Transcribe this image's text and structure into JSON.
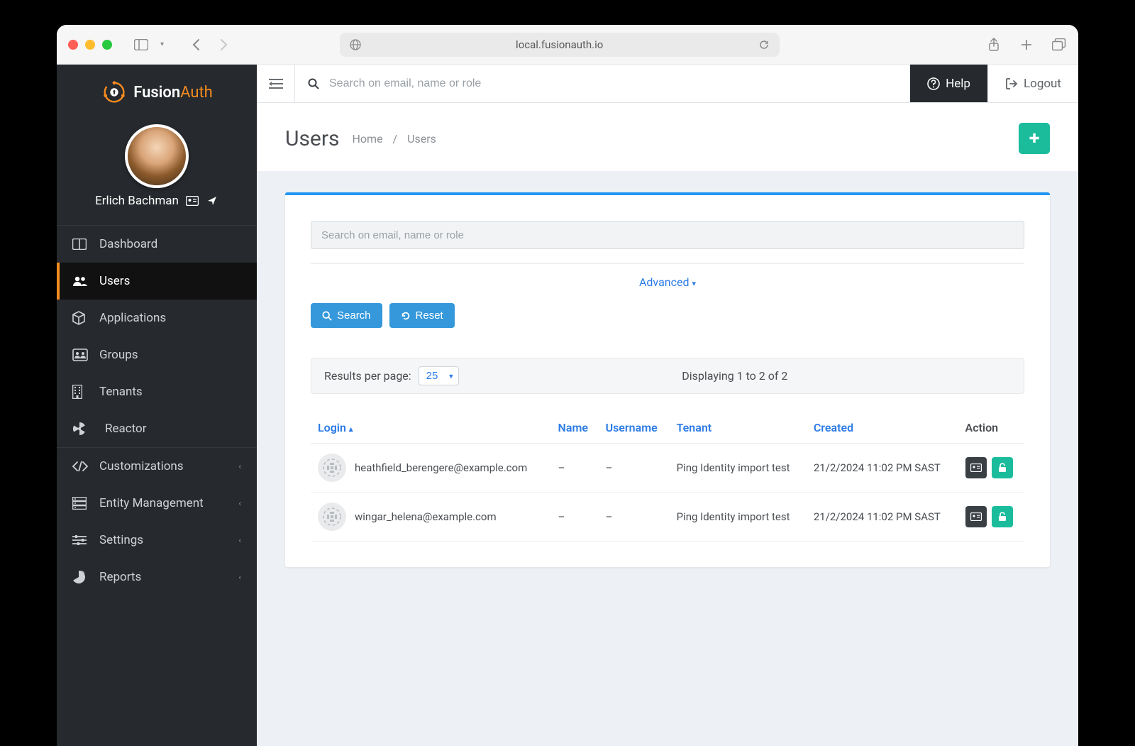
{
  "browser": {
    "url": "local.fusionauth.io"
  },
  "logo": {
    "text_a": "Fusion",
    "text_b": "Auth"
  },
  "user": {
    "name": "Erlich Bachman"
  },
  "sidebar": {
    "items": [
      {
        "label": "Dashboard",
        "icon": "dashboard"
      },
      {
        "label": "Users",
        "icon": "users",
        "active": true
      },
      {
        "label": "Applications",
        "icon": "cube"
      },
      {
        "label": "Groups",
        "icon": "groups"
      },
      {
        "label": "Tenants",
        "icon": "building"
      },
      {
        "label": "Reactor",
        "icon": "radiation",
        "indent": true
      },
      {
        "label": "Customizations",
        "icon": "code",
        "chevron": true
      },
      {
        "label": "Entity Management",
        "icon": "server",
        "chevron": true
      },
      {
        "label": "Settings",
        "icon": "sliders",
        "chevron": true
      },
      {
        "label": "Reports",
        "icon": "piechart",
        "chevron": true
      }
    ]
  },
  "topbar": {
    "search_placeholder": "Search on email, name or role",
    "help": "Help",
    "logout": "Logout"
  },
  "page": {
    "title": "Users",
    "breadcrumb": [
      "Home",
      "Users"
    ]
  },
  "panel": {
    "search_placeholder": "Search on email, name or role",
    "advanced": "Advanced",
    "search_btn": "Search",
    "reset_btn": "Reset",
    "results_per_page_label": "Results per page:",
    "per_page": "25",
    "display_text": "Displaying 1 to 2 of 2",
    "columns": {
      "login": "Login",
      "name": "Name",
      "username": "Username",
      "tenant": "Tenant",
      "created": "Created",
      "action": "Action"
    },
    "rows": [
      {
        "login": "heathfield_berengere@example.com",
        "name": "–",
        "username": "–",
        "tenant": "Ping Identity import test",
        "created": "21/2/2024 11:02 PM SAST"
      },
      {
        "login": "wingar_helena@example.com",
        "name": "–",
        "username": "–",
        "tenant": "Ping Identity import test",
        "created": "21/2/2024 11:02 PM SAST"
      }
    ]
  }
}
